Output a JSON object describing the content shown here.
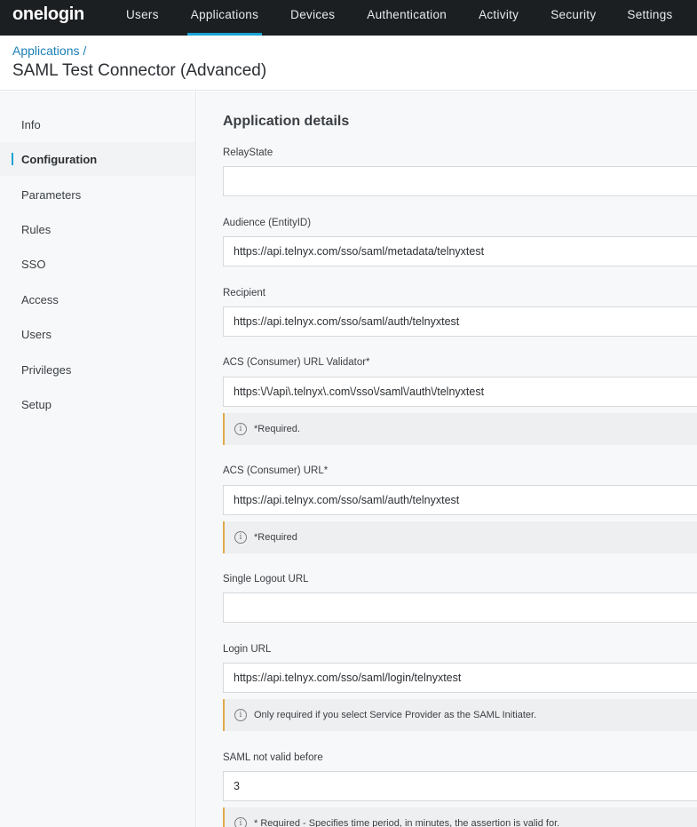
{
  "logo": "onelogin",
  "nav": [
    {
      "label": "Users"
    },
    {
      "label": "Applications"
    },
    {
      "label": "Devices"
    },
    {
      "label": "Authentication"
    },
    {
      "label": "Activity"
    },
    {
      "label": "Security"
    },
    {
      "label": "Settings"
    }
  ],
  "header": {
    "breadcrumb": "Applications /",
    "title": "SAML Test Connector (Advanced)"
  },
  "sidebar": {
    "items": [
      {
        "label": "Info"
      },
      {
        "label": "Configuration"
      },
      {
        "label": "Parameters"
      },
      {
        "label": "Rules"
      },
      {
        "label": "SSO"
      },
      {
        "label": "Access"
      },
      {
        "label": "Users"
      },
      {
        "label": "Privileges"
      },
      {
        "label": "Setup"
      }
    ]
  },
  "main": {
    "section_title": "Application details",
    "fields": {
      "relay_state": {
        "label": "RelayState",
        "value": ""
      },
      "audience": {
        "label": "Audience (EntityID)",
        "value": "https://api.telnyx.com/sso/saml/metadata/telnyxtest"
      },
      "recipient": {
        "label": "Recipient",
        "value": "https://api.telnyx.com/sso/saml/auth/telnyxtest"
      },
      "acs_validator": {
        "label": "ACS (Consumer) URL Validator*",
        "value": "https:\\/\\/api\\.telnyx\\.com\\/sso\\/saml\\/auth\\/telnyxtest",
        "hint": "*Required."
      },
      "acs_url": {
        "label": "ACS (Consumer) URL*",
        "value": "https://api.telnyx.com/sso/saml/auth/telnyxtest",
        "hint": "*Required"
      },
      "single_logout": {
        "label": "Single Logout URL",
        "value": ""
      },
      "login_url": {
        "label": "Login URL",
        "value": "https://api.telnyx.com/sso/saml/login/telnyxtest",
        "hint": "Only required if you select Service Provider as the SAML Initiater."
      },
      "not_valid_before": {
        "label": "SAML not valid before",
        "value": "3",
        "hint": "* Required - Specifies time period, in minutes, the assertion is valid for."
      }
    }
  },
  "colors": {
    "nav_bg": "#1c1f22",
    "accent": "#19a3d5",
    "link": "#1a7fb4",
    "hint_border": "#e0a84a"
  },
  "icons": {
    "info": "info-circle-icon"
  }
}
